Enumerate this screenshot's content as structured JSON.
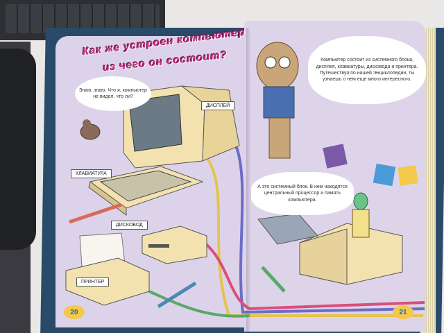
{
  "book": {
    "heading": {
      "line1": "Как же устроен компьютер",
      "line2": "из чего он состоит?"
    },
    "bird_speech": "Знаю, знаю. Что я, компьютер не видел, что ли?",
    "cat_speech": "Компьютер состоит из системного блока, дисплея, клавиатуры, дисковода и принтера. Путешествуя по нашей Энциклопедии, ты узнаешь о нем еще много интересного.",
    "robot_speech": "А это системный блок. В нем находятся центральный процессор и память компьютера.",
    "labels": {
      "display": "ДИСПЛЕЙ",
      "keyboard": "КЛАВИАТУРА",
      "drive": "ДИСКОВОД",
      "printer": "ПРИНТЕР"
    },
    "page_left": "20",
    "page_right": "21"
  },
  "colors": {
    "page": "#ddd4ea",
    "beige": "#f3e2b0",
    "heading": "#c42a7d",
    "page_badge": "#f4c84a"
  }
}
